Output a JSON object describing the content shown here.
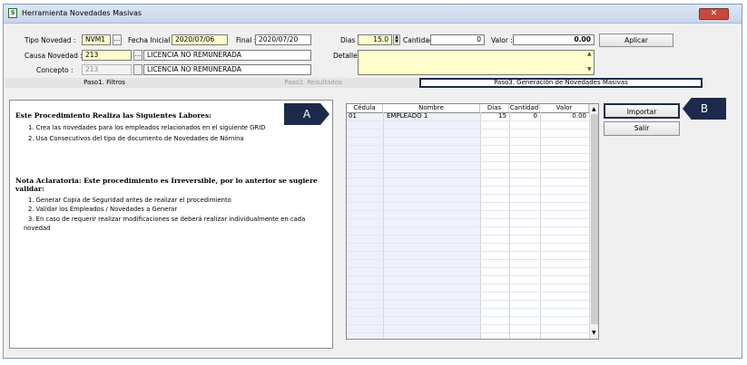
{
  "window": {
    "title": "Herramienta Novedades Masivas",
    "close": "✕"
  },
  "form": {
    "tipo_novedad_label": "Tipo Novedad :",
    "tipo_novedad_value": "NVM1",
    "fecha_inicial_label": "Fecha Inicial :",
    "fecha_inicial_value": "2020/07/06",
    "final_label": "Final :",
    "final_value": "2020/07/20",
    "dias_label": "Dias :",
    "dias_value": "15.0",
    "cantidad_label": "Cantidad :",
    "cantidad_value": "0",
    "valor_label": "Valor :",
    "valor_value": "0.00",
    "aplicar_label": "Aplicar",
    "causa_label": "Causa Novedad :",
    "causa_code": "213",
    "causa_desc": "LICENCIA NO REMUNERADA",
    "detalle_label": "Detalle :",
    "concepto_label": "Concepto :",
    "concepto_code": "213",
    "concepto_desc": "LICENCIA NO REMUNERADA",
    "dots": "..."
  },
  "tabs": [
    "Paso1. Filtros",
    "Paso2. Resultados",
    "Paso3. Generación de Novedades Masivas"
  ],
  "info": {
    "heading1": "Este Procedimiento Realiza las Siguientes Labores:",
    "item1": "1. Crea las novedades para los empleados relacionados en el siguiente GRID",
    "item2": "2. Usa Consecutivos del tipo de documento de Novedades de Nómina",
    "heading2a": "Nota Aclaratoria: Este procedimiento es Irreversible, por lo anterior se sugiere",
    "heading2b": "validar:",
    "note1": "1. Generar Copia de Seguridad antes de realizar el procedimiento",
    "note2": "2.  Validar los Empleados / Novedades a Generar",
    "note3a": "3. En caso de requerir realizar modificaciones se deberá realizar individualmente en cada",
    "note3b": "novedad"
  },
  "grid": {
    "columns": [
      "Cédula",
      "Nombre",
      "Dias",
      "Cantidad",
      "Valor"
    ],
    "rows": [
      {
        "cedula": "01",
        "nombre": "EMPLEADO 1",
        "dias": "15",
        "cantidad": "0",
        "valor": "0.00"
      }
    ]
  },
  "actions": {
    "importar": "Importar",
    "salir": "Salir"
  },
  "callouts": {
    "a": "A",
    "b": "B"
  },
  "colors": {
    "callout": "#1c2a4c",
    "highlight": "#ffffcc",
    "grid_name_col": "#eef1fb"
  }
}
